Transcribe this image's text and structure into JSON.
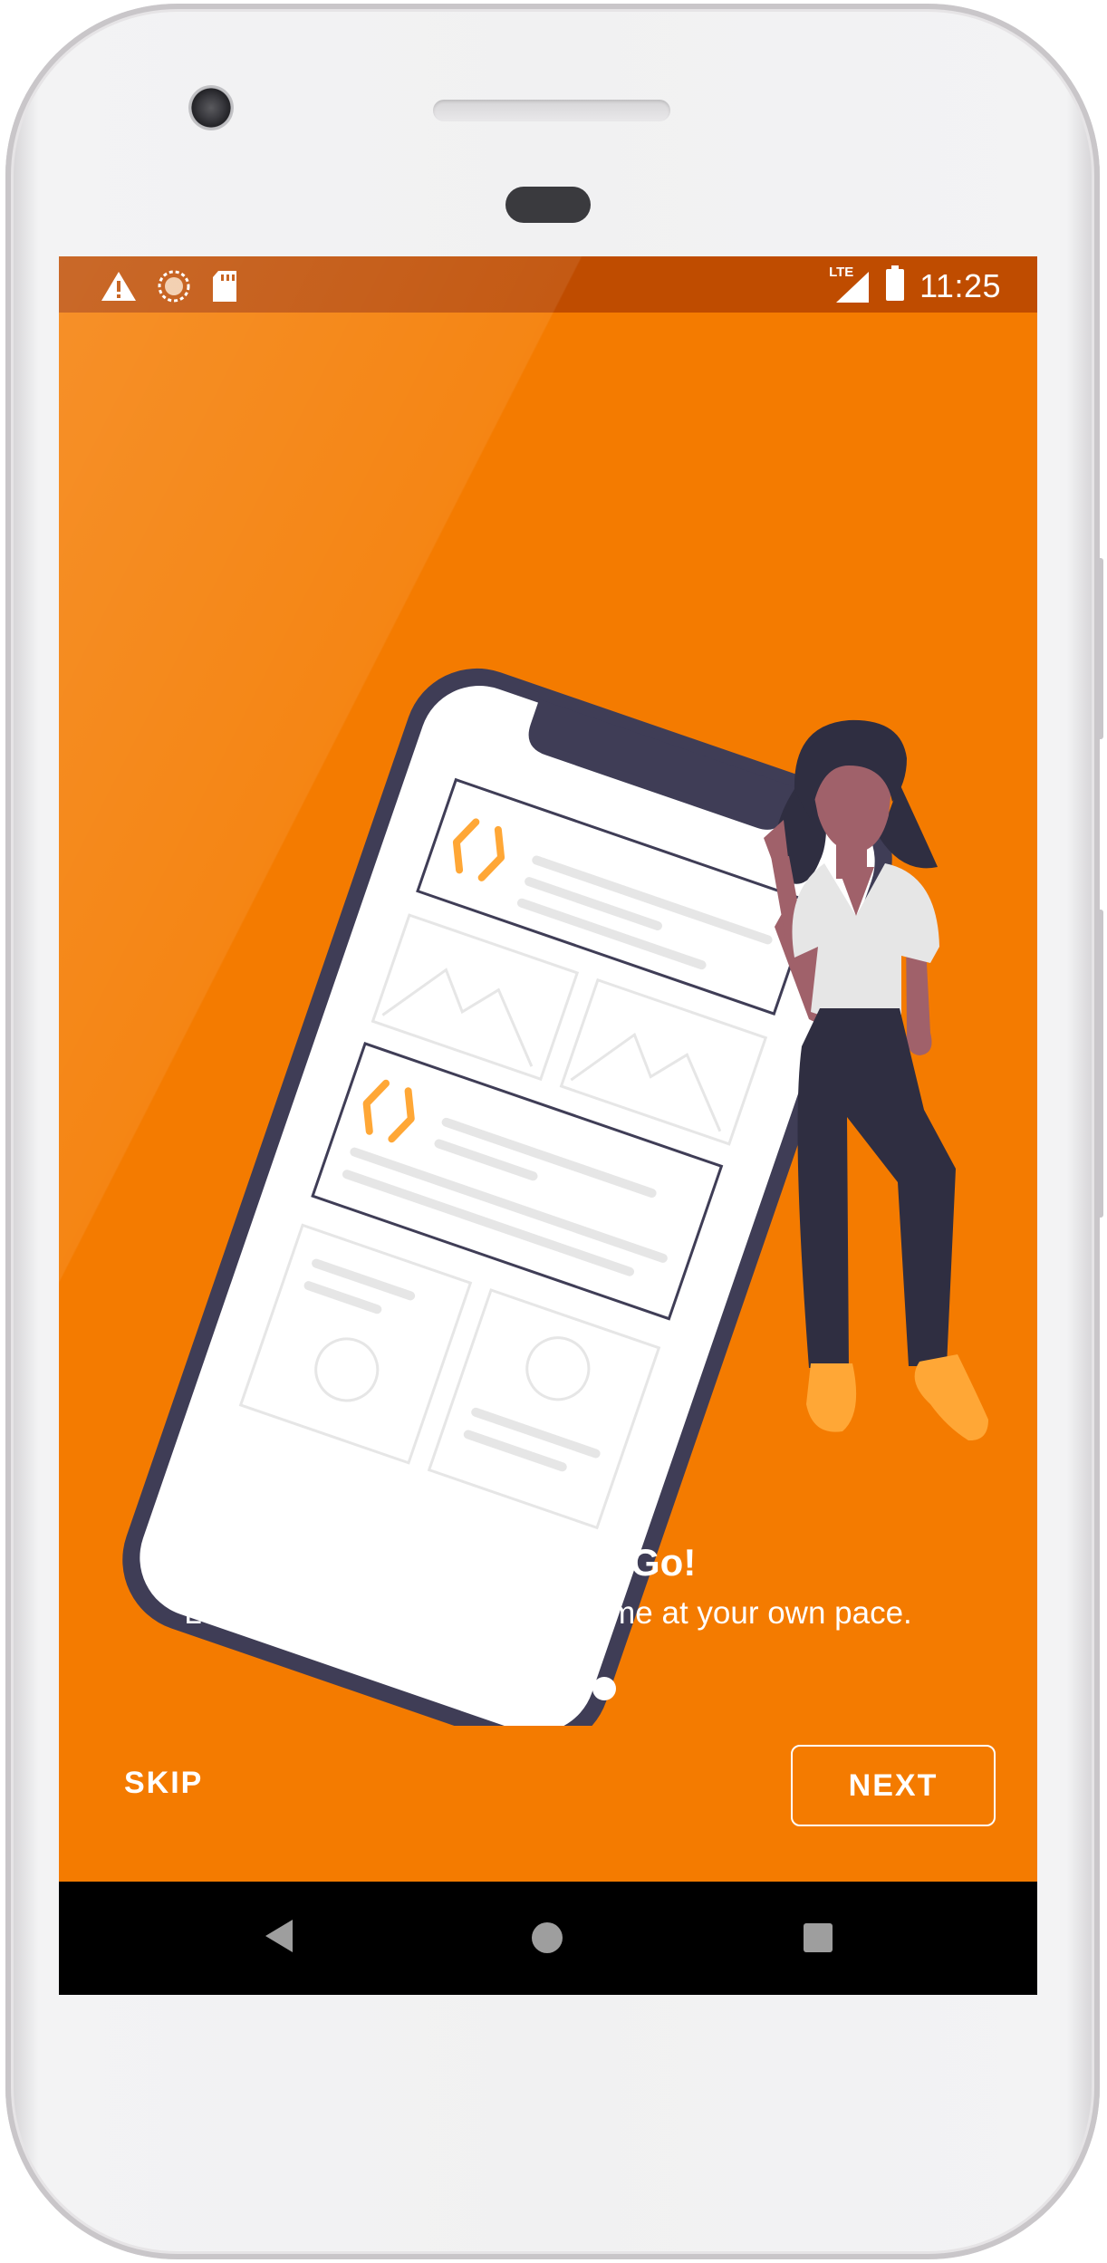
{
  "status_bar": {
    "time": "11:25",
    "network_label": "LTE",
    "icons": [
      "warning-icon",
      "sync-icon",
      "sd-card-icon",
      "signal-icon",
      "battery-icon"
    ]
  },
  "onboarding": {
    "title": "Code on the Go!",
    "subtitle": "Learn to code anywhere, anytime at your own pace.",
    "page_indicator": {
      "current": 1,
      "total": 3
    },
    "skip_label": "SKIP",
    "next_label": "NEXT"
  },
  "nav_bar": {
    "icons": [
      "back-icon",
      "home-icon",
      "recents-icon"
    ]
  },
  "colors": {
    "background": "#f47b00",
    "status_bar": "#bf4c00",
    "accent": "#ffa736",
    "illustration_dark": "#3f3d56",
    "skin": "#a0616a"
  }
}
